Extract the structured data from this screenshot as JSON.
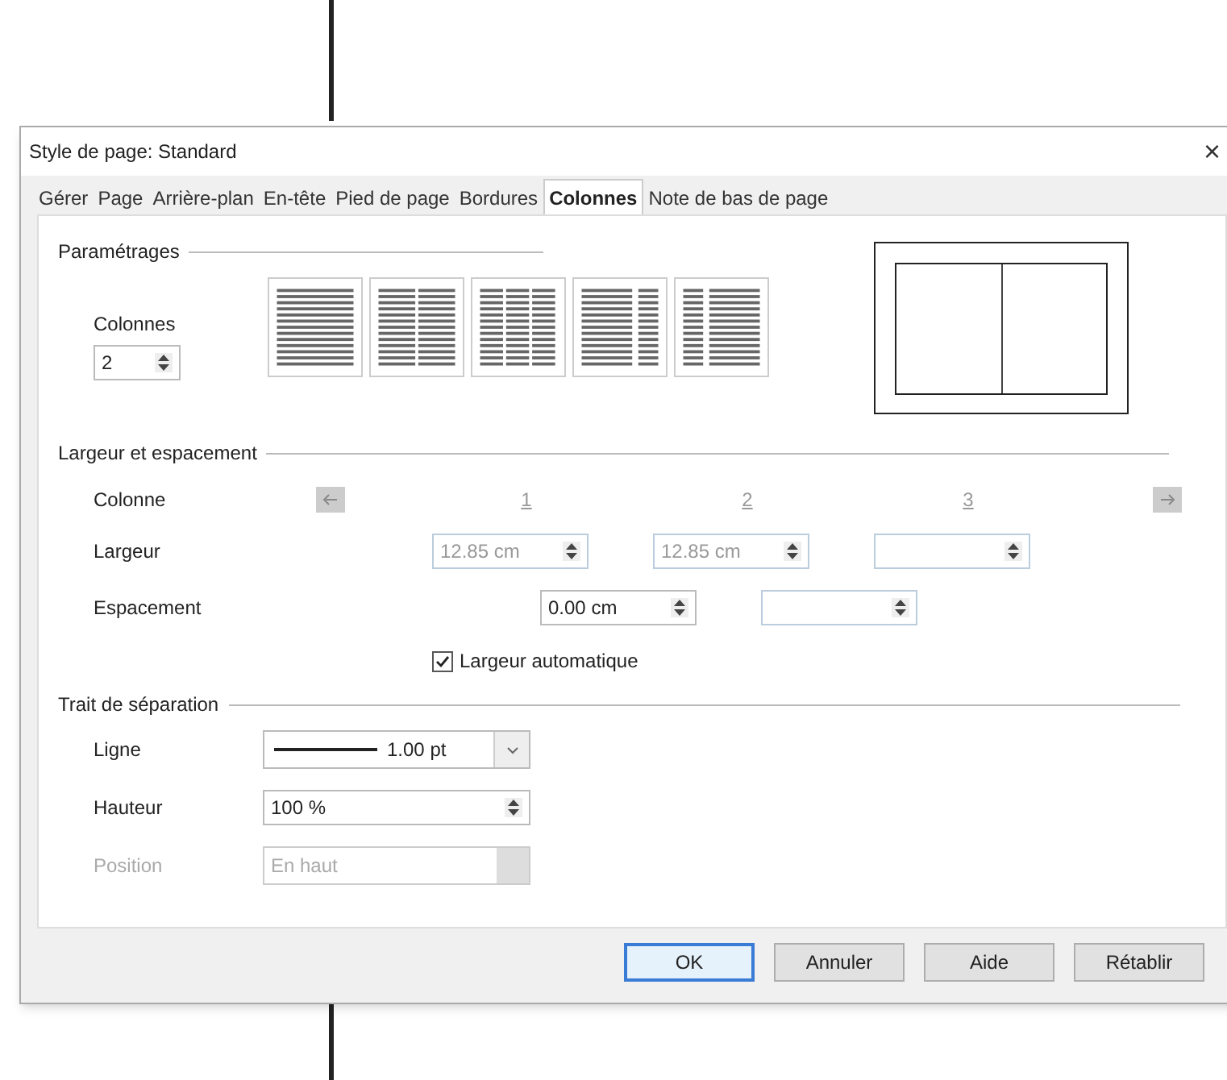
{
  "window": {
    "title": "Style de page: Standard",
    "close": "×"
  },
  "tabs": [
    {
      "label": "Gérer",
      "selected": false
    },
    {
      "label": "Page",
      "selected": false
    },
    {
      "label": "Arrière-plan",
      "selected": false
    },
    {
      "label": "En-tête",
      "selected": false
    },
    {
      "label": "Pied de page",
      "selected": false
    },
    {
      "label": "Bordures",
      "selected": false
    },
    {
      "label": "Colonnes",
      "selected": true
    },
    {
      "label": "Note de bas de page",
      "selected": false
    }
  ],
  "settings": {
    "title": "Paramétrages",
    "columns_label": "Colonnes",
    "columns_value": "2",
    "presets": [
      {
        "kind": "one"
      },
      {
        "kind": "two"
      },
      {
        "kind": "three"
      },
      {
        "kind": "left"
      },
      {
        "kind": "right"
      }
    ]
  },
  "width_spacing": {
    "title": "Largeur et espacement",
    "column_label": "Colonne",
    "column_numbers": [
      "1",
      "2",
      "3"
    ],
    "width_label": "Largeur",
    "widths": [
      {
        "value": "12.85 cm",
        "disabled": true
      },
      {
        "value": "12.85 cm",
        "disabled": true
      },
      {
        "disabled": true
      }
    ],
    "spacing_label": "Espacement",
    "spacings": [
      {
        "value": "0.00 cm",
        "disabled": false
      },
      {
        "disabled": true
      }
    ],
    "auto_width": {
      "label": "Largeur automatique",
      "checked": true
    }
  },
  "separator": {
    "title": "Trait de séparation",
    "line_label": "Ligne",
    "line_value": "1.00 pt",
    "height_label": "Hauteur",
    "height_value": "100 %",
    "position_label": "Position",
    "position_value": "En haut",
    "position_disabled": true
  },
  "buttons": [
    {
      "label": "OK",
      "default": true
    },
    {
      "label": "Annuler",
      "default": false
    },
    {
      "label": "Aide",
      "default": false
    },
    {
      "label": "Rétablir",
      "default": false
    }
  ]
}
